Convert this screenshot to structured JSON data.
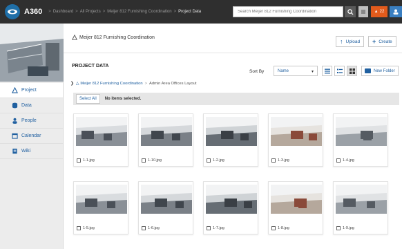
{
  "app": {
    "brand": "A360",
    "breadcrumbs": [
      "Dashboard",
      "All Projects",
      "Meijer 812 Furnishing Coordination",
      "Project Data"
    ],
    "search_placeholder": "Search Meijer 812 Furnishing Coordination",
    "alert_count": "22"
  },
  "sidebar": {
    "items": [
      {
        "label": "Project",
        "icon": "project-icon"
      },
      {
        "label": "Data",
        "icon": "data-icon"
      },
      {
        "label": "People",
        "icon": "people-icon"
      },
      {
        "label": "Calendar",
        "icon": "calendar-icon"
      },
      {
        "label": "Wiki",
        "icon": "wiki-icon"
      }
    ]
  },
  "main": {
    "project_name": "Meijer 812 Furnishing Coordination",
    "upload_label": "Upload",
    "create_label": "Create",
    "section_title": "PROJECT DATA",
    "sort_label": "Sort By",
    "sort_value": "Name",
    "new_folder_label": "New Folder",
    "path": [
      "Meijer 812 Furnishing Coordination",
      "Admin Area Offices Layout"
    ],
    "select_all_label": "Select All",
    "selection_status": "No items selected.",
    "files": [
      {
        "name": "1-1.jpg"
      },
      {
        "name": "1-10.jpg"
      },
      {
        "name": "1-2.jpg"
      },
      {
        "name": "1-3.jpg"
      },
      {
        "name": "1-4.jpg"
      },
      {
        "name": "1-5.jpg"
      },
      {
        "name": "1-6.jpg"
      },
      {
        "name": "1-7.jpg"
      },
      {
        "name": "1-8.jpg"
      },
      {
        "name": "1-9.jpg"
      }
    ]
  },
  "colors": {
    "accent": "#2060a0",
    "topbar": "#2f2f2f",
    "alert": "#e25b1c"
  }
}
